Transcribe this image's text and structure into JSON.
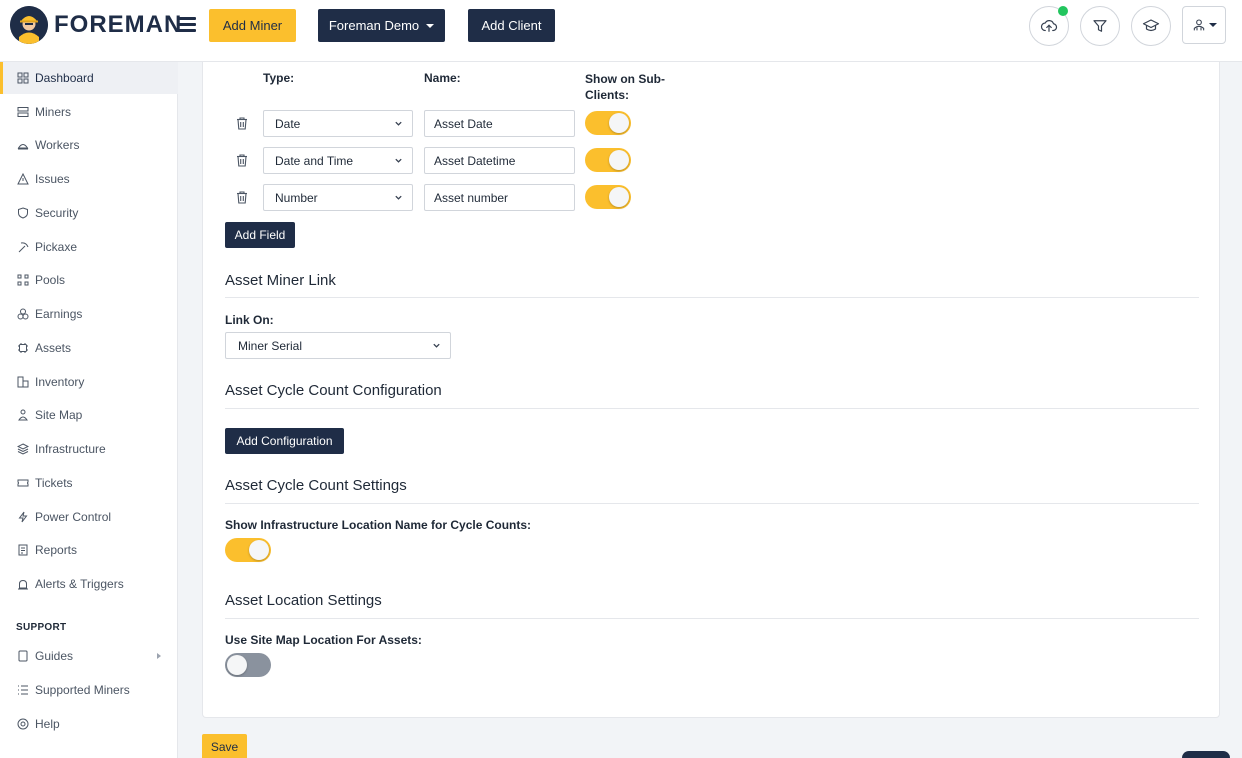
{
  "header": {
    "brand": "FOREMAN",
    "add_miner": "Add Miner",
    "client_select": "Foreman Demo",
    "add_client": "Add Client"
  },
  "sidebar": {
    "items": [
      {
        "label": "Dashboard",
        "icon": "dashboard-icon"
      },
      {
        "label": "Miners",
        "icon": "server-icon"
      },
      {
        "label": "Workers",
        "icon": "workers-icon"
      },
      {
        "label": "Issues",
        "icon": "warning-icon"
      },
      {
        "label": "Security",
        "icon": "shield-icon"
      },
      {
        "label": "Pickaxe",
        "icon": "pickaxe-icon"
      },
      {
        "label": "Pools",
        "icon": "pools-icon"
      },
      {
        "label": "Earnings",
        "icon": "coins-icon"
      },
      {
        "label": "Assets",
        "icon": "chip-icon"
      },
      {
        "label": "Inventory",
        "icon": "inventory-icon"
      },
      {
        "label": "Site Map",
        "icon": "sitemap-icon"
      },
      {
        "label": "Infrastructure",
        "icon": "layers-icon"
      },
      {
        "label": "Tickets",
        "icon": "ticket-icon"
      },
      {
        "label": "Power Control",
        "icon": "bolt-icon"
      },
      {
        "label": "Reports",
        "icon": "report-icon"
      },
      {
        "label": "Alerts & Triggers",
        "icon": "alarm-icon"
      }
    ],
    "support_heading": "SUPPORT",
    "support_items": [
      {
        "label": "Guides",
        "icon": "book-icon"
      },
      {
        "label": "Supported Miners",
        "icon": "list-icon"
      },
      {
        "label": "Help",
        "icon": "help-icon"
      }
    ]
  },
  "fields": {
    "col_type": "Type:",
    "col_name": "Name:",
    "col_show": "Show on Sub-Clients:",
    "col_show_line1": "Show on Sub-",
    "col_show_line2": "Clients:",
    "rows": [
      {
        "type": "Date",
        "name": "Asset Date",
        "show": true
      },
      {
        "type": "Date and Time",
        "name": "Asset Datetime",
        "show": true
      },
      {
        "type": "Number",
        "name": "Asset number",
        "show": true
      }
    ],
    "add_field": "Add Field"
  },
  "miner_link": {
    "title": "Asset Miner Link",
    "link_on_label": "Link On:",
    "link_on_value": "Miner Serial"
  },
  "cycle_config": {
    "title": "Asset Cycle Count Configuration",
    "add_configuration": "Add Configuration"
  },
  "cycle_settings": {
    "title": "Asset Cycle Count Settings",
    "infra_label": "Show Infrastructure Location Name for Cycle Counts:",
    "infra_value": true
  },
  "location_settings": {
    "title": "Asset Location Settings",
    "sitemap_label": "Use Site Map Location For Assets:",
    "sitemap_value": false
  },
  "footer": {
    "save": "Save"
  },
  "colors": {
    "navy": "#1f2d47",
    "yellow": "#fbbf2d",
    "status_green": "#22c55e"
  }
}
